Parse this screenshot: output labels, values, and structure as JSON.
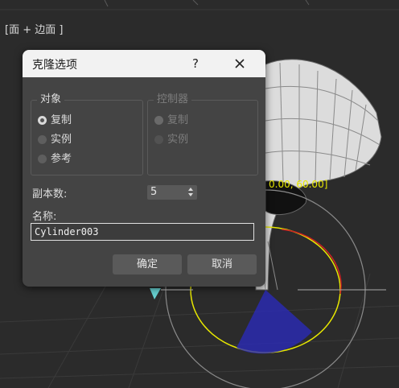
{
  "viewport": {
    "label": "[面 + 边面 ]",
    "overlay_text": "0.00, 60.00]"
  },
  "dialog": {
    "title": "克隆选项",
    "help_label": "?",
    "object_group": {
      "title": "对象",
      "options": [
        "复制",
        "实例",
        "参考"
      ],
      "selected": "复制"
    },
    "controller_group": {
      "title": "控制器",
      "options": [
        "复制",
        "实例"
      ],
      "selected": "复制",
      "enabled": false
    },
    "copies": {
      "label": "副本数:",
      "value": "5"
    },
    "name": {
      "label": "名称:",
      "value": "Cylinder003"
    },
    "ok_label": "确定",
    "cancel_label": "取消"
  },
  "colors": {
    "viewport_bg": "#2b2b2b",
    "dialog_bg": "#444444",
    "titlebar_bg": "#f2f2f2",
    "gizmo_yellow": "#e8e800",
    "gizmo_red": "#cc2222",
    "gizmo_blue": "#2a2ab8"
  }
}
